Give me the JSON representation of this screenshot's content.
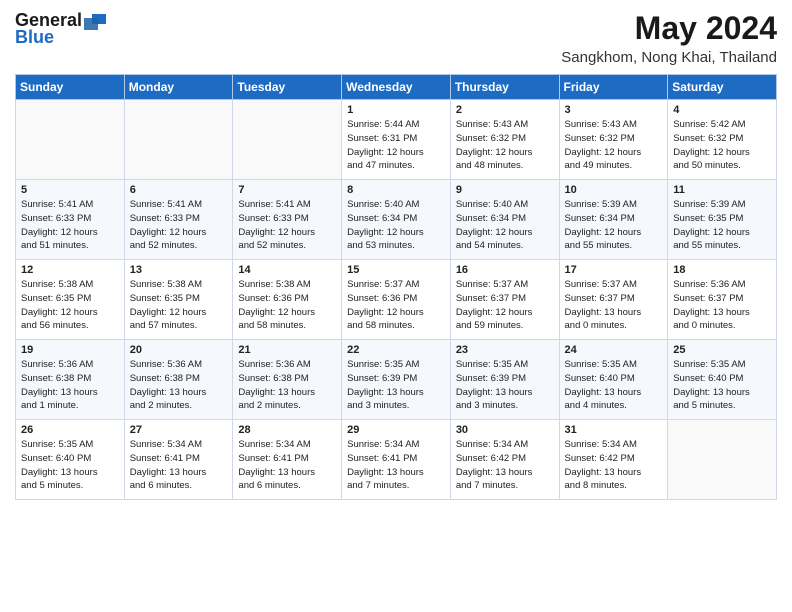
{
  "logo": {
    "general": "General",
    "blue": "Blue"
  },
  "title": "May 2024",
  "location": "Sangkhom, Nong Khai, Thailand",
  "weekdays": [
    "Sunday",
    "Monday",
    "Tuesday",
    "Wednesday",
    "Thursday",
    "Friday",
    "Saturday"
  ],
  "weeks": [
    [
      {
        "day": "",
        "detail": ""
      },
      {
        "day": "",
        "detail": ""
      },
      {
        "day": "",
        "detail": ""
      },
      {
        "day": "1",
        "detail": "Sunrise: 5:44 AM\nSunset: 6:31 PM\nDaylight: 12 hours\nand 47 minutes."
      },
      {
        "day": "2",
        "detail": "Sunrise: 5:43 AM\nSunset: 6:32 PM\nDaylight: 12 hours\nand 48 minutes."
      },
      {
        "day": "3",
        "detail": "Sunrise: 5:43 AM\nSunset: 6:32 PM\nDaylight: 12 hours\nand 49 minutes."
      },
      {
        "day": "4",
        "detail": "Sunrise: 5:42 AM\nSunset: 6:32 PM\nDaylight: 12 hours\nand 50 minutes."
      }
    ],
    [
      {
        "day": "5",
        "detail": "Sunrise: 5:41 AM\nSunset: 6:33 PM\nDaylight: 12 hours\nand 51 minutes."
      },
      {
        "day": "6",
        "detail": "Sunrise: 5:41 AM\nSunset: 6:33 PM\nDaylight: 12 hours\nand 52 minutes."
      },
      {
        "day": "7",
        "detail": "Sunrise: 5:41 AM\nSunset: 6:33 PM\nDaylight: 12 hours\nand 52 minutes."
      },
      {
        "day": "8",
        "detail": "Sunrise: 5:40 AM\nSunset: 6:34 PM\nDaylight: 12 hours\nand 53 minutes."
      },
      {
        "day": "9",
        "detail": "Sunrise: 5:40 AM\nSunset: 6:34 PM\nDaylight: 12 hours\nand 54 minutes."
      },
      {
        "day": "10",
        "detail": "Sunrise: 5:39 AM\nSunset: 6:34 PM\nDaylight: 12 hours\nand 55 minutes."
      },
      {
        "day": "11",
        "detail": "Sunrise: 5:39 AM\nSunset: 6:35 PM\nDaylight: 12 hours\nand 55 minutes."
      }
    ],
    [
      {
        "day": "12",
        "detail": "Sunrise: 5:38 AM\nSunset: 6:35 PM\nDaylight: 12 hours\nand 56 minutes."
      },
      {
        "day": "13",
        "detail": "Sunrise: 5:38 AM\nSunset: 6:35 PM\nDaylight: 12 hours\nand 57 minutes."
      },
      {
        "day": "14",
        "detail": "Sunrise: 5:38 AM\nSunset: 6:36 PM\nDaylight: 12 hours\nand 58 minutes."
      },
      {
        "day": "15",
        "detail": "Sunrise: 5:37 AM\nSunset: 6:36 PM\nDaylight: 12 hours\nand 58 minutes."
      },
      {
        "day": "16",
        "detail": "Sunrise: 5:37 AM\nSunset: 6:37 PM\nDaylight: 12 hours\nand 59 minutes."
      },
      {
        "day": "17",
        "detail": "Sunrise: 5:37 AM\nSunset: 6:37 PM\nDaylight: 13 hours\nand 0 minutes."
      },
      {
        "day": "18",
        "detail": "Sunrise: 5:36 AM\nSunset: 6:37 PM\nDaylight: 13 hours\nand 0 minutes."
      }
    ],
    [
      {
        "day": "19",
        "detail": "Sunrise: 5:36 AM\nSunset: 6:38 PM\nDaylight: 13 hours\nand 1 minute."
      },
      {
        "day": "20",
        "detail": "Sunrise: 5:36 AM\nSunset: 6:38 PM\nDaylight: 13 hours\nand 2 minutes."
      },
      {
        "day": "21",
        "detail": "Sunrise: 5:36 AM\nSunset: 6:38 PM\nDaylight: 13 hours\nand 2 minutes."
      },
      {
        "day": "22",
        "detail": "Sunrise: 5:35 AM\nSunset: 6:39 PM\nDaylight: 13 hours\nand 3 minutes."
      },
      {
        "day": "23",
        "detail": "Sunrise: 5:35 AM\nSunset: 6:39 PM\nDaylight: 13 hours\nand 3 minutes."
      },
      {
        "day": "24",
        "detail": "Sunrise: 5:35 AM\nSunset: 6:40 PM\nDaylight: 13 hours\nand 4 minutes."
      },
      {
        "day": "25",
        "detail": "Sunrise: 5:35 AM\nSunset: 6:40 PM\nDaylight: 13 hours\nand 5 minutes."
      }
    ],
    [
      {
        "day": "26",
        "detail": "Sunrise: 5:35 AM\nSunset: 6:40 PM\nDaylight: 13 hours\nand 5 minutes."
      },
      {
        "day": "27",
        "detail": "Sunrise: 5:34 AM\nSunset: 6:41 PM\nDaylight: 13 hours\nand 6 minutes."
      },
      {
        "day": "28",
        "detail": "Sunrise: 5:34 AM\nSunset: 6:41 PM\nDaylight: 13 hours\nand 6 minutes."
      },
      {
        "day": "29",
        "detail": "Sunrise: 5:34 AM\nSunset: 6:41 PM\nDaylight: 13 hours\nand 7 minutes."
      },
      {
        "day": "30",
        "detail": "Sunrise: 5:34 AM\nSunset: 6:42 PM\nDaylight: 13 hours\nand 7 minutes."
      },
      {
        "day": "31",
        "detail": "Sunrise: 5:34 AM\nSunset: 6:42 PM\nDaylight: 13 hours\nand 8 minutes."
      },
      {
        "day": "",
        "detail": ""
      }
    ]
  ]
}
